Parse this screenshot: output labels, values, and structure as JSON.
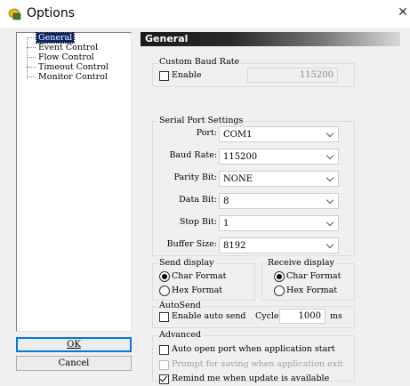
{
  "window": {
    "title": "Options",
    "icon": "app-icon",
    "close_icon": "close-icon"
  },
  "tree": {
    "items": [
      {
        "label": "General",
        "selected": true
      },
      {
        "label": "Event Control",
        "selected": false
      },
      {
        "label": "Flow Control",
        "selected": false
      },
      {
        "label": "Timeout Control",
        "selected": false
      },
      {
        "label": "Monitor Control",
        "selected": false
      }
    ]
  },
  "buttons": {
    "ok_label": "OK",
    "cancel_label": "Cancel"
  },
  "panel": {
    "header": "General"
  },
  "custom_baud": {
    "group_label": "Custom Baud Rate",
    "enable_label": "Enable",
    "enable_checked": false,
    "value": "115200"
  },
  "serial": {
    "group_label": "Serial Port Settings",
    "fields": [
      {
        "label": "Port:",
        "value": "COM1"
      },
      {
        "label": "Baud Rate:",
        "value": "115200"
      },
      {
        "label": "Parity Bit:",
        "value": "NONE"
      },
      {
        "label": "Data Bit:",
        "value": "8"
      },
      {
        "label": "Stop Bit:",
        "value": "1"
      },
      {
        "label": "Buffer Size:",
        "value": "8192"
      }
    ]
  },
  "send_display": {
    "group_label": "Send display",
    "char_label": "Char Format",
    "hex_label": "Hex  Format",
    "selected": "char"
  },
  "receive_display": {
    "group_label": "Receive display",
    "char_label": "Char Format",
    "hex_label": "Hex  Format",
    "selected": "char"
  },
  "autosend": {
    "group_label": "AutoSend",
    "enable_label": "Enable auto send",
    "enable_checked": false,
    "cycle_label": "Cycle",
    "cycle_value": "1000",
    "unit": "ms"
  },
  "advanced": {
    "group_label": "Advanced",
    "auto_open_label": "Auto open port when application start",
    "auto_open_checked": false,
    "prompt_save_label": "Prompt for saving when application exit",
    "prompt_save_checked": false,
    "prompt_save_disabled": true,
    "remind_update_label": "Remind me when update is available",
    "remind_update_checked": true
  }
}
